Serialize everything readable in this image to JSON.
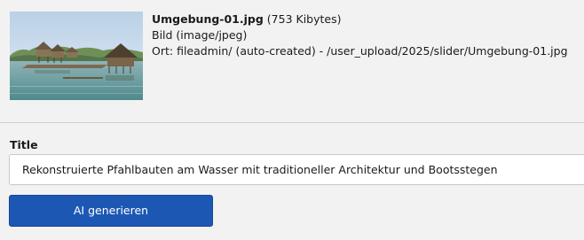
{
  "file": {
    "name": "Umgebung-01.jpg",
    "size": "(753 Kibytes)",
    "type": "Bild (image/jpeg)",
    "location": "Ort: fileadmin/ (auto-created) - /user_upload/2025/slider/Umgebung-01.jpg"
  },
  "title_field": {
    "label": "Title",
    "value": "Rekonstruierte Pfahlbauten am Wasser mit traditioneller Architektur und Bootsstegen"
  },
  "ai_button": {
    "label": "AI generieren"
  }
}
